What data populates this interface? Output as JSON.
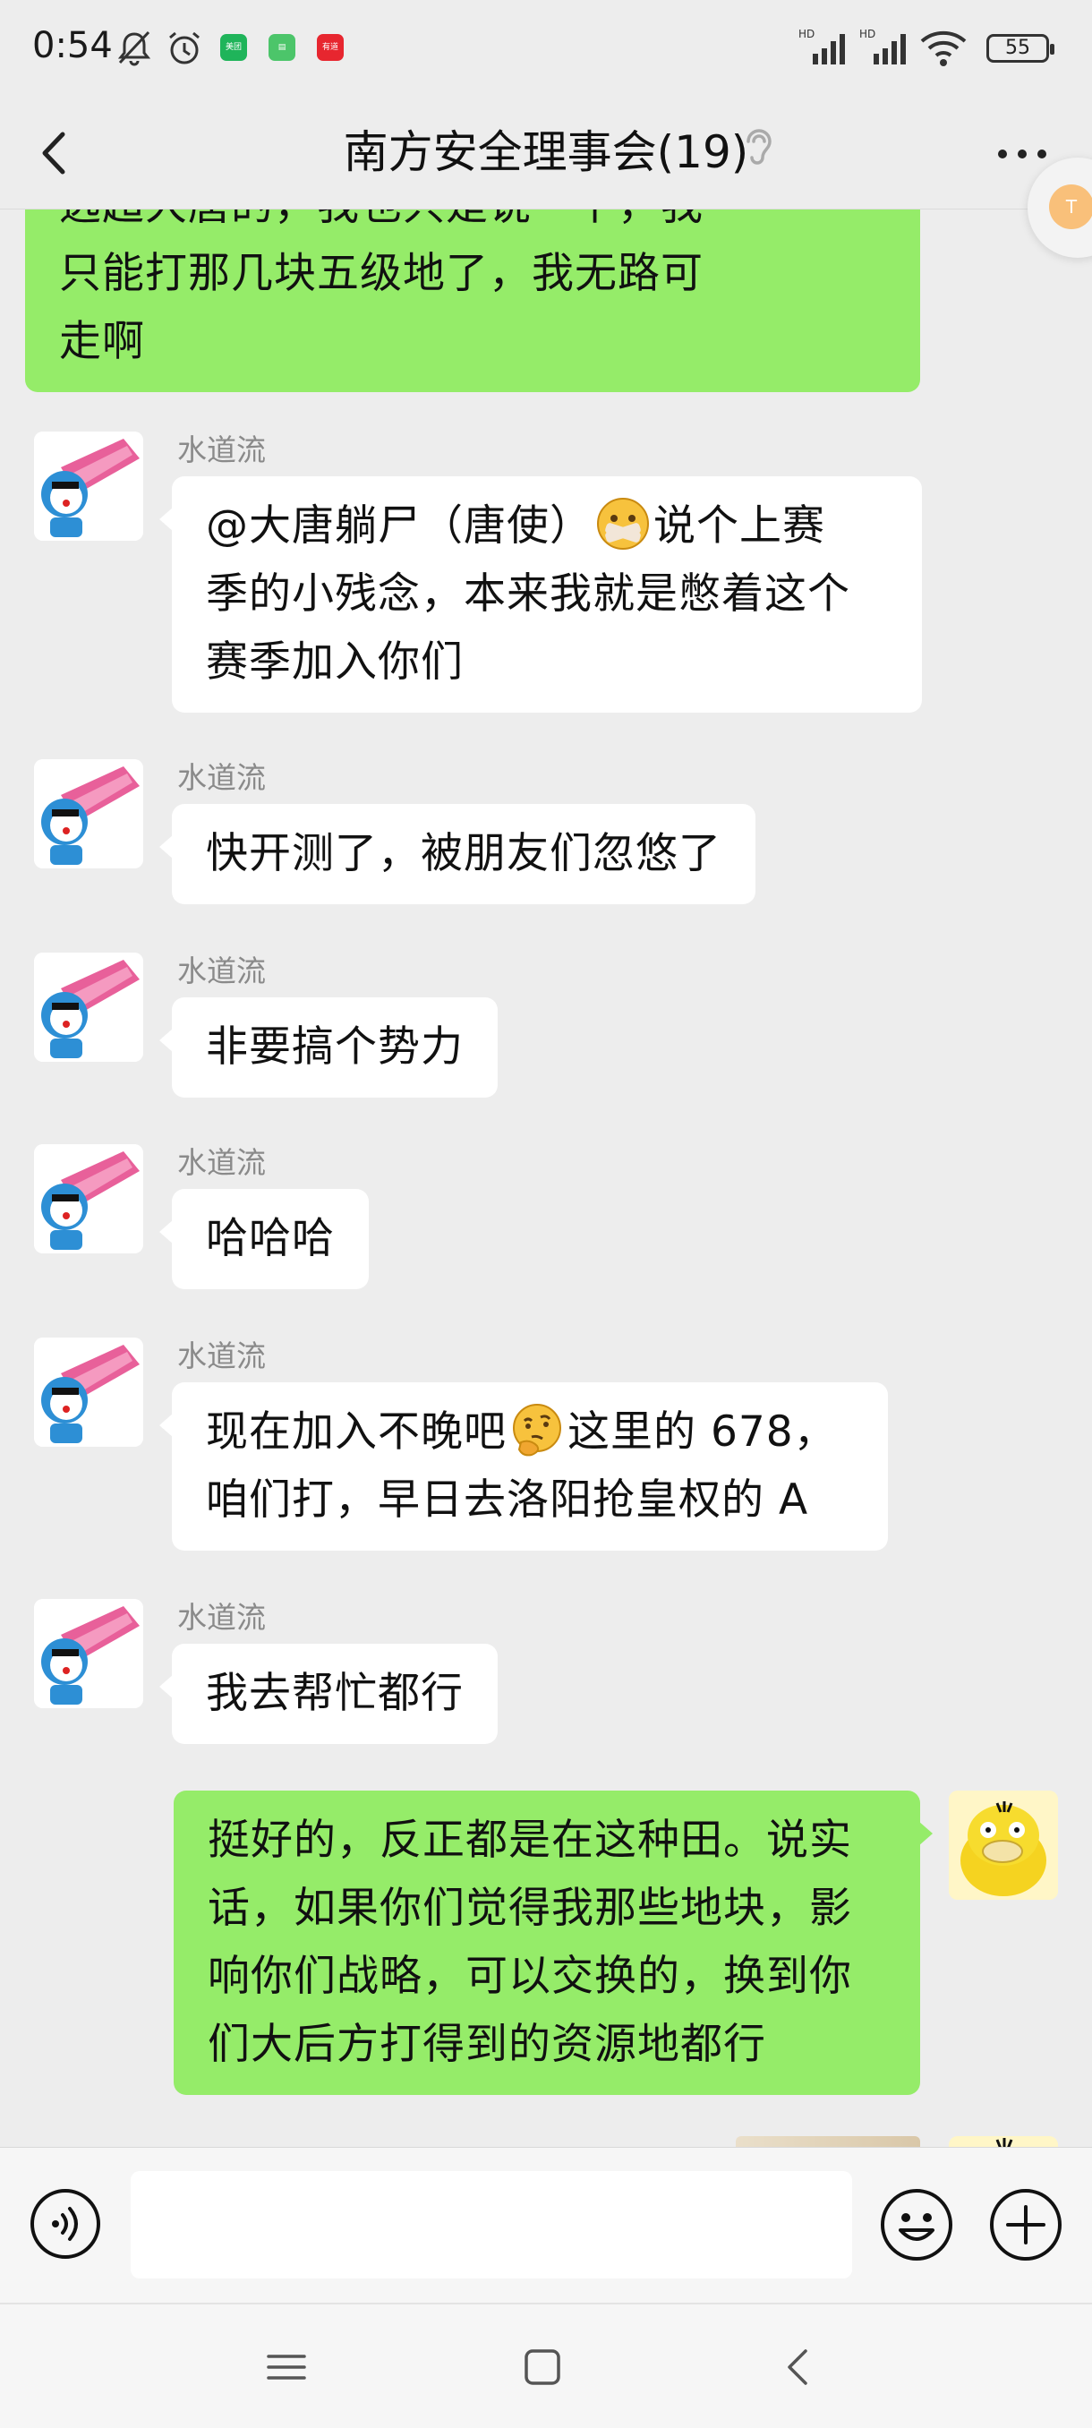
{
  "status_bar": {
    "time": "0:54",
    "battery": "55",
    "app_badges": [
      {
        "name": "meituan-badge",
        "label": "美团",
        "color": "#1fb45a"
      },
      {
        "name": "app-badge-green",
        "label": "▤",
        "color": "#4cc56a"
      },
      {
        "name": "youdao-badge",
        "label": "有道",
        "color": "#e7262f"
      }
    ]
  },
  "nav": {
    "title": "南方安全理事会(19)"
  },
  "float_badge": {
    "label": "T"
  },
  "colors": {
    "out_bubble": "#95ec69",
    "in_bubble": "#ffffff",
    "background": "#ededed"
  },
  "messages": [
    {
      "side": "out",
      "lines": [
        "远超大唐的，我也只是说一下，我",
        "只能打那几块五级地了，我无路可",
        "走啊"
      ]
    },
    {
      "side": "in",
      "sender": "水道流",
      "text_parts": [
        "@大唐躺尸（唐使）",
        "说个上赛",
        "季的小残念，本来我就是憋着这个",
        "赛季加入你们"
      ],
      "emoji": "zipper-mouth-emoji"
    },
    {
      "side": "in",
      "sender": "水道流",
      "text": "快开测了，被朋友们忽悠了"
    },
    {
      "side": "in",
      "sender": "水道流",
      "text": "非要搞个势力"
    },
    {
      "side": "in",
      "sender": "水道流",
      "text": "哈哈哈"
    },
    {
      "side": "in",
      "sender": "水道流",
      "text_parts": [
        "现在加入不晚吧",
        "这里的 678，",
        "咱们打，早日去洛阳抢皇权的 A"
      ],
      "emoji": "thinking-emoji"
    },
    {
      "side": "in",
      "sender": "水道流",
      "text": "我去帮忙都行"
    },
    {
      "side": "out",
      "lines": [
        "挺好的，反正都是在这种田。说实",
        "话，如果你们觉得我那些地块，影",
        "响你们战略，可以交换的，换到你",
        "们大后方打得到的资源地都行"
      ]
    }
  ],
  "input": {
    "value": ""
  }
}
